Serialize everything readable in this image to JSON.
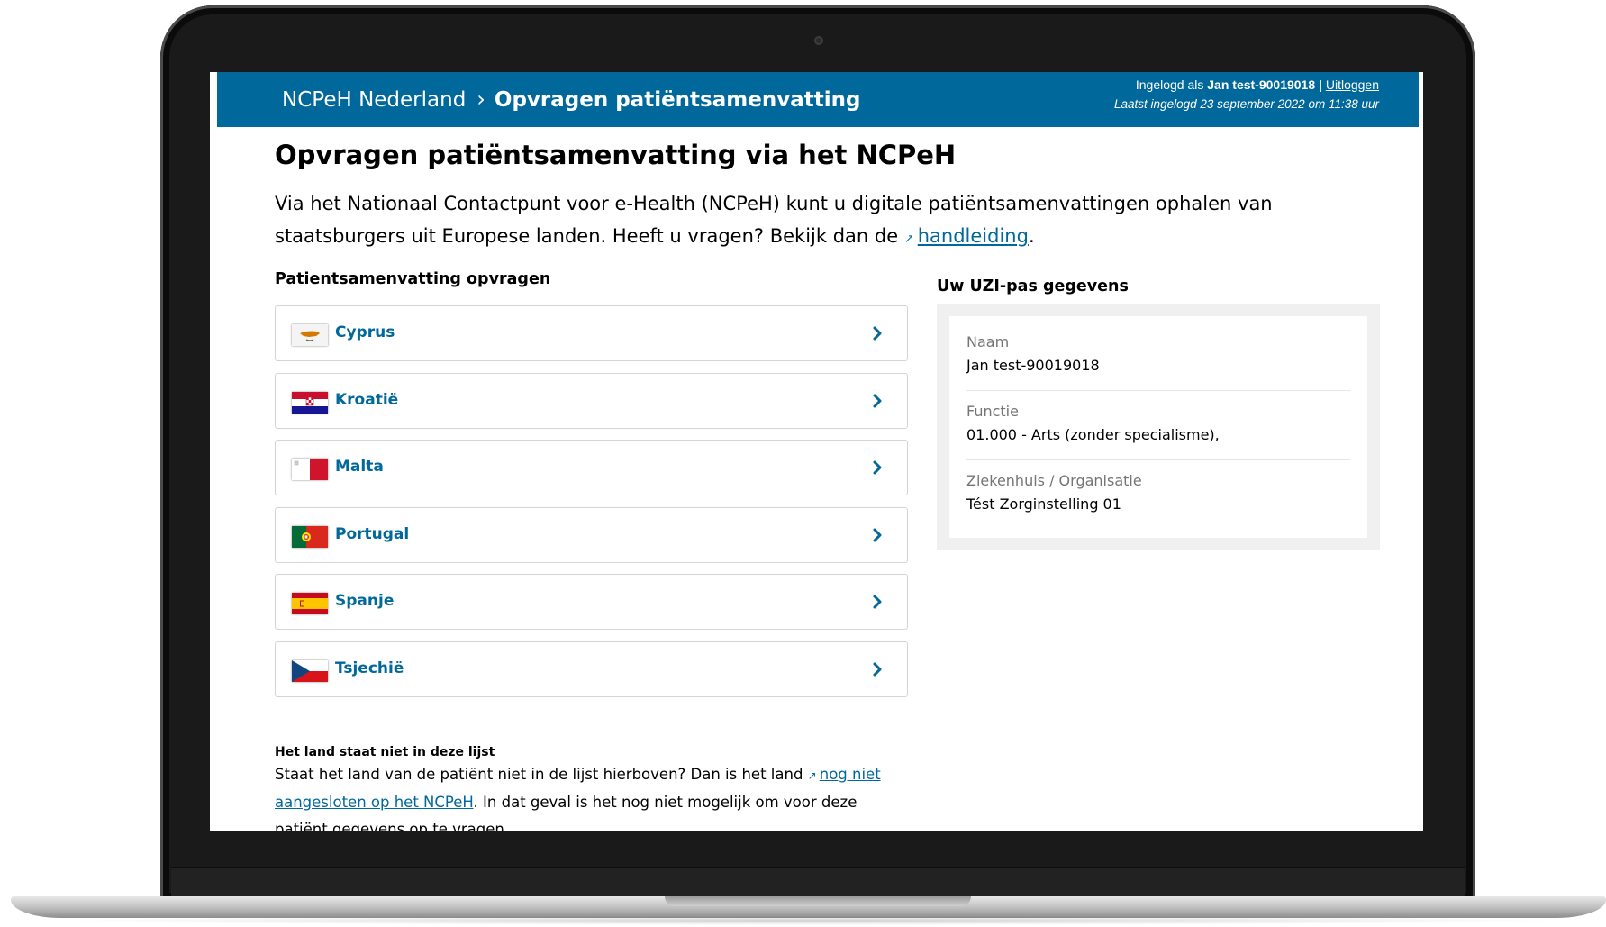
{
  "header": {
    "breadcrumb_home": "NCPeH Nederland",
    "breadcrumb_separator": "›",
    "breadcrumb_current": "Opvragen patiëntsamenvatting",
    "logged_in_prefix": "Ingelogd als ",
    "user_name": "Jan test-90019018",
    "separator": " | ",
    "logout_label": "Uitloggen",
    "last_login": "Laatst ingelogd 23 september 2022 om 11:38 uur"
  },
  "page": {
    "title": "Opvragen patiëntsamenvatting via het NCPeH",
    "intro_text": "Via het Nationaal Contactpunt voor e-Health (NCPeH) kunt u digitale patiëntsamenvattingen ophalen van staatsburgers uit Europese landen. Heeft u vragen? Bekijk dan de ",
    "intro_link": "handleiding",
    "intro_end": ".",
    "external_icon": "↗"
  },
  "countries_section": {
    "heading": "Patientsamenvatting opvragen",
    "items": [
      {
        "name": "Cyprus",
        "flag": "cyprus-flag"
      },
      {
        "name": "Kroatië",
        "flag": "croatia-flag"
      },
      {
        "name": "Malta",
        "flag": "malta-flag"
      },
      {
        "name": "Portugal",
        "flag": "portugal-flag"
      },
      {
        "name": "Spanje",
        "flag": "spain-flag"
      },
      {
        "name": "Tsjechië",
        "flag": "czechia-flag"
      }
    ]
  },
  "uzi": {
    "heading": "Uw UZI-pas gegevens",
    "name_label": "Naam",
    "name_value": "Jan test-90019018",
    "function_label": "Functie",
    "function_value": "01.000 - Arts (zonder specialisme),",
    "org_label": "Ziekenhuis / Organisatie",
    "org_value": "Tést Zorginstelling 01"
  },
  "not_listed": {
    "heading": "Het land staat niet in deze lijst",
    "text_start": "Staat het land van de patiënt niet in de lijst hierboven? Dan is het land ",
    "link": "nog niet aangesloten op het NCPeH",
    "text_end": ". In dat geval is het nog niet mogelijk om voor deze patiënt gegevens op te vragen."
  },
  "colors": {
    "header_blue": "#01689b",
    "link_blue": "#01689b",
    "panel_grey": "#f0f0f0"
  }
}
